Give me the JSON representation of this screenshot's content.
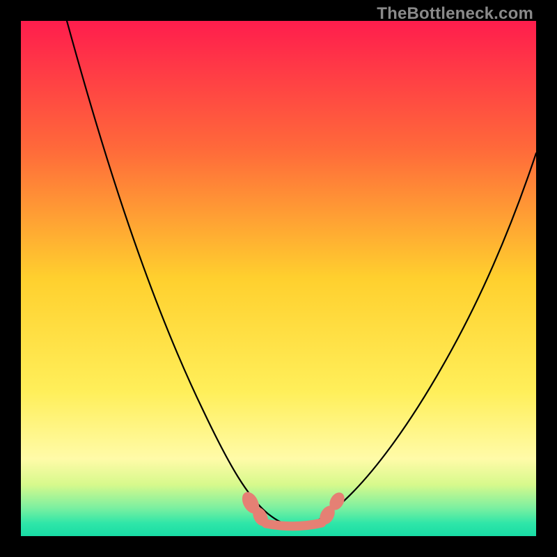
{
  "watermark": "TheBottleneck.com",
  "colors": {
    "black": "#000000",
    "watermark_text": "#8a8a8a",
    "curve": "#000000",
    "marker": "#e58074",
    "grad_stops": [
      {
        "offset": 0,
        "color": "#ff1d4d"
      },
      {
        "offset": 0.25,
        "color": "#ff6a3a"
      },
      {
        "offset": 0.5,
        "color": "#ffd02e"
      },
      {
        "offset": 0.72,
        "color": "#ffef5a"
      },
      {
        "offset": 0.85,
        "color": "#fffba8"
      },
      {
        "offset": 0.9,
        "color": "#d7f98c"
      },
      {
        "offset": 0.945,
        "color": "#7cf0a0"
      },
      {
        "offset": 0.975,
        "color": "#2fe6a8"
      },
      {
        "offset": 1.0,
        "color": "#18dca5"
      }
    ]
  },
  "chart_data": {
    "type": "line",
    "title": "",
    "xlabel": "",
    "ylabel": "",
    "xlim": [
      0,
      100
    ],
    "ylim": [
      0,
      100
    ],
    "grid": false,
    "legend": false,
    "note": "V-shaped bottleneck curve. Y=100 at top (worst) to Y≈0 at bottom (best). Minimum plateau roughly x≈48–58 at y≈2. Values are visual estimates read off the plotted line relative to the square plot area.",
    "series": [
      {
        "name": "bottleneck_percent",
        "x": [
          9,
          12,
          16,
          20,
          24,
          28,
          32,
          36,
          39,
          42,
          45,
          48,
          50,
          53,
          56,
          58,
          61,
          64,
          68,
          72,
          76,
          80,
          84,
          88,
          92,
          96,
          100
        ],
        "y": [
          100,
          86,
          73,
          62,
          52,
          43,
          35,
          28,
          22,
          16,
          10,
          5,
          3,
          2,
          2,
          3,
          6,
          11,
          17,
          24,
          31,
          38,
          46,
          54,
          63,
          72,
          82
        ]
      }
    ],
    "optimal_region": {
      "x_start": 48,
      "x_end": 58,
      "y": 2
    },
    "markers": [
      {
        "x": 44,
        "y": 9
      },
      {
        "x": 46,
        "y": 5
      },
      {
        "x": 58,
        "y": 5
      },
      {
        "x": 60,
        "y": 8
      }
    ]
  }
}
